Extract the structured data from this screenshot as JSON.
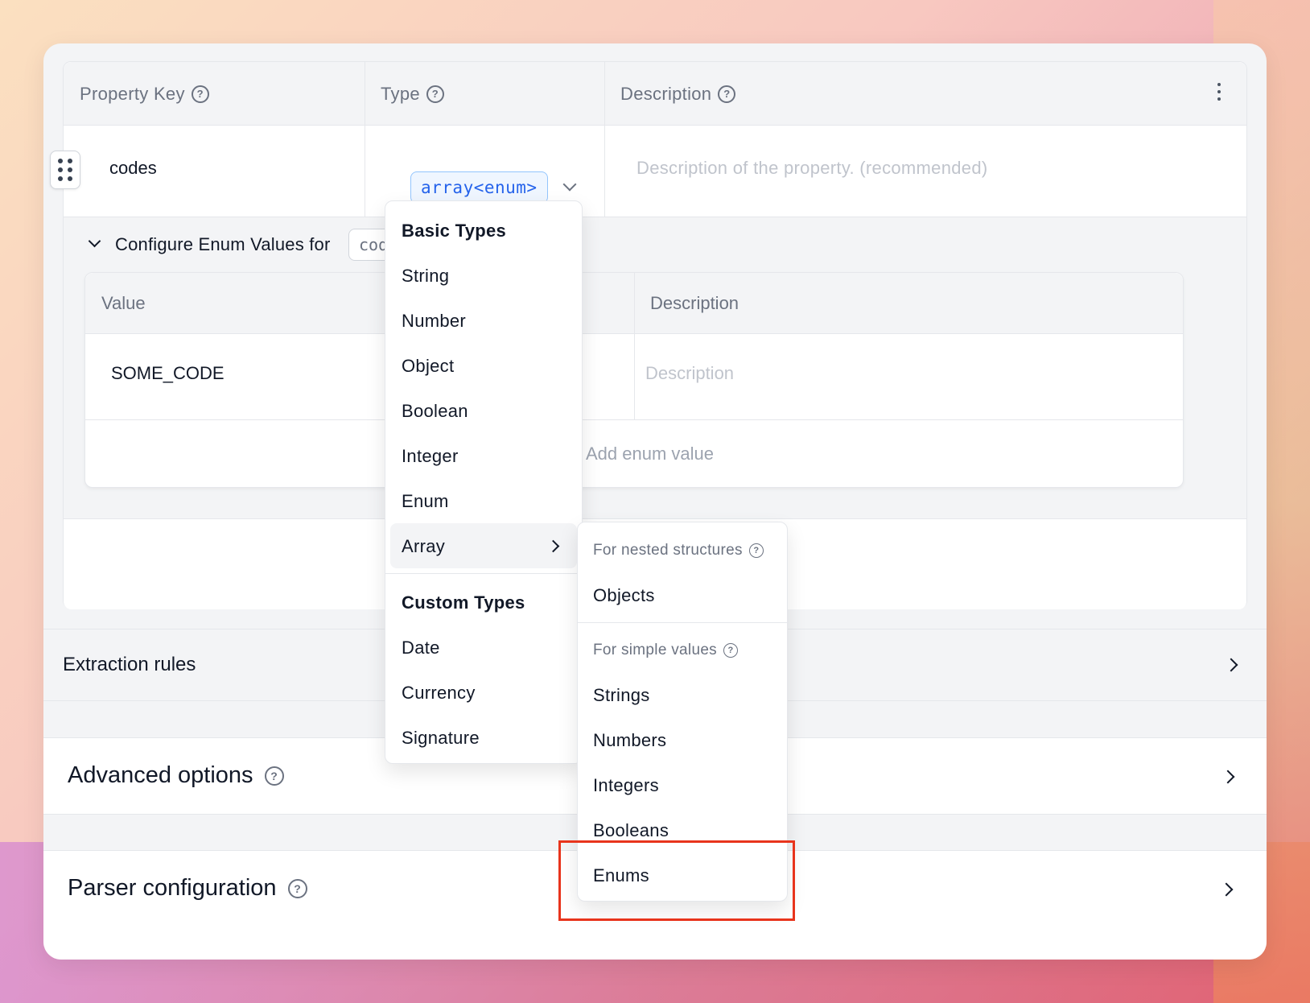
{
  "table": {
    "headers": {
      "property_key": "Property Key",
      "type": "Type",
      "description": "Description"
    },
    "row": {
      "key": "codes",
      "type_chip": "array<enum>",
      "description_placeholder": "Description of the property. (recommended)"
    }
  },
  "enum_config": {
    "title": "Configure Enum Values for",
    "chip": "codes",
    "headers": {
      "value": "Value",
      "description": "Description"
    },
    "rows": [
      {
        "value": "SOME_CODE",
        "description_placeholder": "Description"
      }
    ],
    "add_label": "Add enum value"
  },
  "sections": {
    "extraction_rules": "Extraction rules",
    "advanced_options": "Advanced options",
    "parser_configuration": "Parser configuration"
  },
  "type_menu": {
    "basic_header": "Basic Types",
    "basic_items": [
      "String",
      "Number",
      "Object",
      "Boolean",
      "Integer",
      "Enum",
      "Array"
    ],
    "custom_header": "Custom Types",
    "custom_items": [
      "Date",
      "Currency",
      "Signature"
    ]
  },
  "array_submenu": {
    "nested_label": "For nested structures",
    "nested_items": [
      "Objects"
    ],
    "simple_label": "For simple values",
    "simple_items": [
      "Strings",
      "Numbers",
      "Integers",
      "Booleans",
      "Enums"
    ]
  },
  "icons": {
    "help": "?",
    "highlight_color": "#e8341c",
    "accent_color": "#2563eb"
  }
}
